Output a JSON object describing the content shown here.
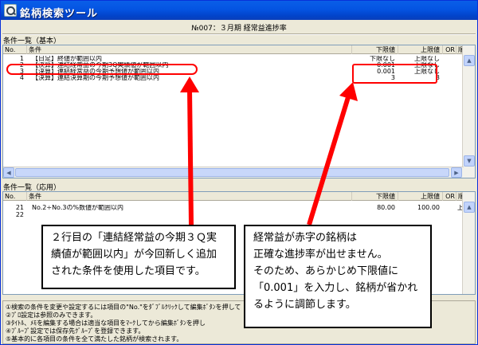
{
  "window": {
    "title": "銘柄検索ツール"
  },
  "report_heading": "№007：３月期 経常益進捗率",
  "basic": {
    "section_label": "条件一覧（基本）",
    "columns": {
      "no": "No.",
      "condition": "条件",
      "lower": "下限値",
      "upper": "上限値",
      "or": "OR",
      "order": "順"
    },
    "rows": [
      {
        "no": "1",
        "condition": "【日足】終値が範囲以内",
        "lower": "下限なし",
        "upper": "上限なし"
      },
      {
        "no": "2",
        "condition": "【決算】連結経常益の今期3Q実績値が範囲以内",
        "lower": "0.001",
        "upper": "上限なし"
      },
      {
        "no": "3",
        "condition": "【決算】連結経常益の今期予想値が範囲以内",
        "lower": "0.001",
        "upper": "上限なし"
      },
      {
        "no": "4",
        "condition": "【決算】連結決算期の今期予想値が範囲以内",
        "lower": "3",
        "upper": "3"
      }
    ]
  },
  "applied": {
    "section_label": "条件一覧（応用）",
    "columns": {
      "no": "No.",
      "condition": "条件",
      "lower": "下限値",
      "upper": "上限値",
      "or": "OR",
      "order": "順"
    },
    "rows": [
      {
        "no": "21",
        "condition": "No.2÷No.3の%数値が範囲以内",
        "lower": "80.00",
        "upper": "100.00",
        "order": "上"
      },
      {
        "no": "22",
        "condition": "",
        "lower": "",
        "upper": ""
      }
    ]
  },
  "footer_notes": [
    "①検索の条件を変更や設定するには項目の\"No.\"をﾀﾞﾌﾞﾙｸﾘｯｸして編集ﾎﾞﾀﾝを押して",
    "②ﾌﾟﾛ設定は参照のみできます。",
    "③ﾀｲﾄﾙ、ﾒﾓを編集する場合は適当な項目をﾏｰｸしてから編集ﾎﾞﾀﾝを押し",
    "④ﾌﾞﾙｰﾌﾟ設定では保存先ｸﾞﾙｰﾌﾟを登録できます。",
    "⑤基本的に各項目の条件を全て満たした銘柄が検索されます。"
  ],
  "annotations": {
    "left_callout": [
      "２行目の「連結経常益の今期３Ｑ実",
      "績値が範囲以内」が今回新しく追加",
      "された条件を使用した項目です。"
    ],
    "right_callout": [
      "経常益が赤字の銘柄は",
      "正確な進捗率が出せません。",
      "そのため、あらかじめ下限値に",
      "「0.001」を入力し、銘柄が省かれ",
      "るように調節します。"
    ],
    "highlight_color": "#ff0000"
  }
}
